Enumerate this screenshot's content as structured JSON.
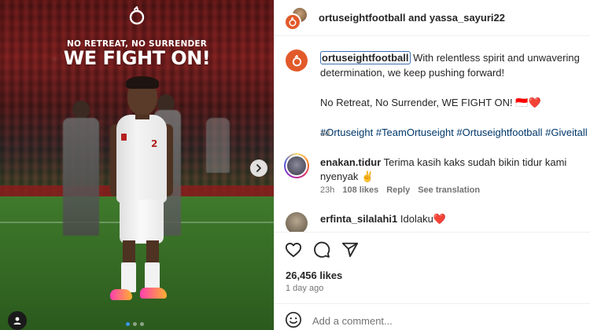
{
  "media": {
    "headline_sub": "NO RETREAT, NO SURRENDER",
    "headline_main": "WE FIGHT ON!",
    "shirt_number": "2",
    "carousel": {
      "total": 3,
      "active": 1
    }
  },
  "header": {
    "user1": "ortuseightfootball",
    "and": " and ",
    "user2": "yassa_sayuri22"
  },
  "caption": {
    "username": "ortuseightfootball",
    "line1": " With relentless spirit and unwavering determination, we keep pushing forward!",
    "line2": "No Retreat, No Surrender, WE FIGHT ON! 🇮🇩❤️",
    "hashtags": "#Ortuseight #TeamOrtuseight #Ortuseightfootball #Giveitall",
    "time": "1d"
  },
  "comments": [
    {
      "username": "enakan.tidur",
      "text": " Terima kasih kaks sudah bikin tidur kami nyenyak ✌️",
      "time": "23h",
      "likes": "108 likes",
      "reply": "Reply",
      "translate": "See translation"
    },
    {
      "username": "erfinta_silalahi1",
      "text": " Idolaku❤️"
    }
  ],
  "actions": {
    "likes": "26,456 likes",
    "time_ago": "1 day ago"
  },
  "add_comment": {
    "placeholder": "Add a comment..."
  },
  "colors": {
    "brand": "#e25a2a",
    "hashtag": "#00376b",
    "muted": "#737373",
    "carousel_active": "#3797f0"
  }
}
